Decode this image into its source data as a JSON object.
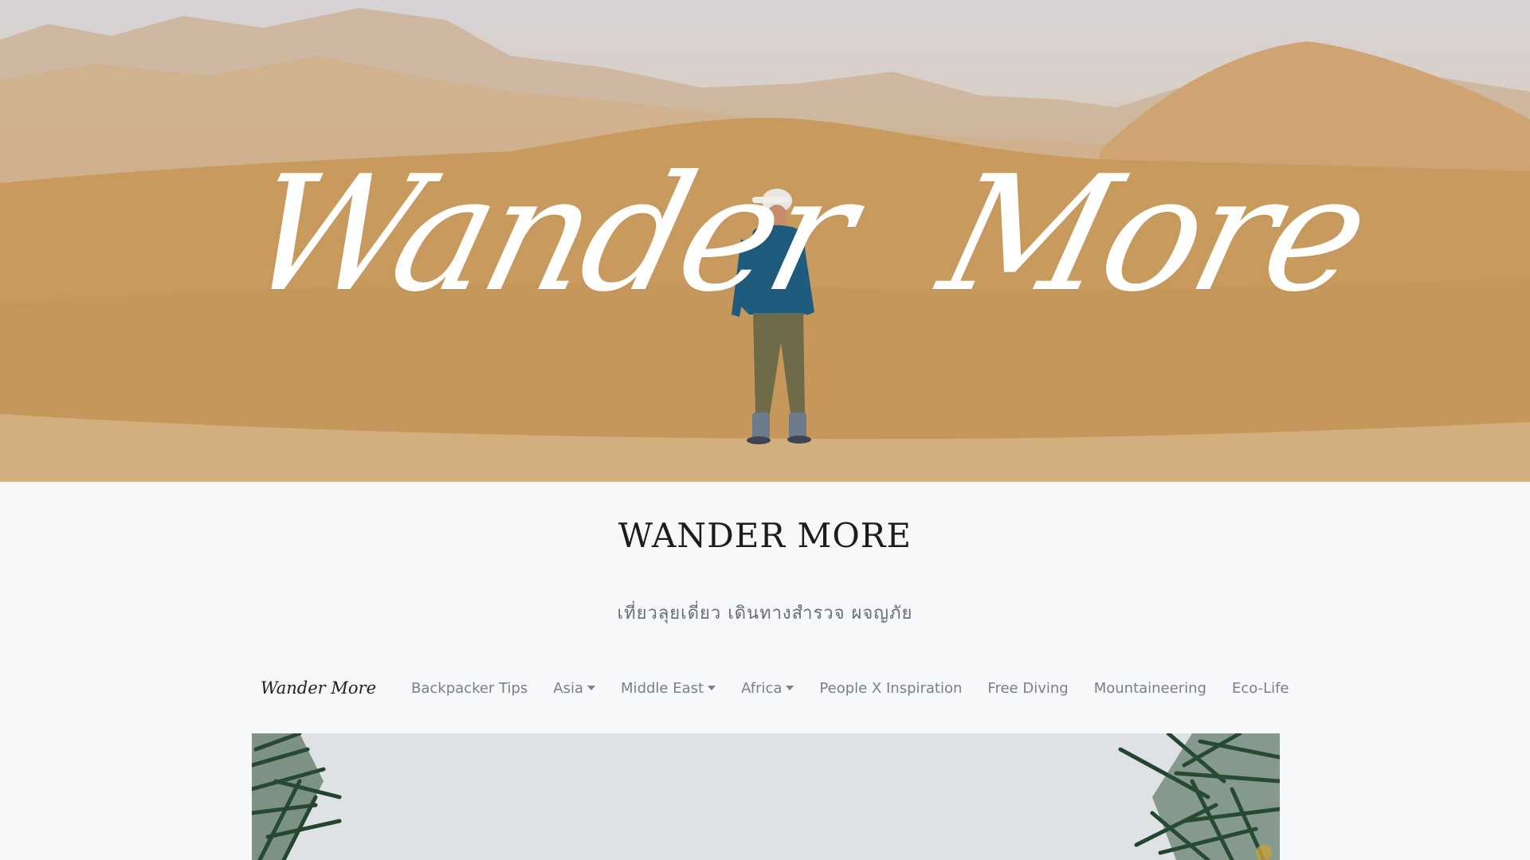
{
  "hero": {
    "script_word_left": "Wander",
    "script_word_right": "More",
    "icons": [
      "desert-dunes-illustration",
      "hiker-figure-illustration"
    ]
  },
  "header": {
    "title": "WANDER MORE",
    "tagline": "เที่ยวลุยเดี่ยว เดินทางสำรวจ ผจญภัย"
  },
  "nav": {
    "brand": "Wander More",
    "items": [
      {
        "label": "Backpacker Tips",
        "has_dropdown": false
      },
      {
        "label": "Asia",
        "has_dropdown": true
      },
      {
        "label": "Middle East",
        "has_dropdown": true
      },
      {
        "label": "Africa",
        "has_dropdown": true
      },
      {
        "label": "People X Inspiration",
        "has_dropdown": false
      },
      {
        "label": "Free Diving",
        "has_dropdown": false
      },
      {
        "label": "Mountaineering",
        "has_dropdown": false
      },
      {
        "label": "Eco-Life",
        "has_dropdown": false
      }
    ]
  },
  "feature": {
    "icons": [
      "palm-trees-illustration"
    ]
  },
  "colors": {
    "background": "#f7f8fa",
    "title_text": "#1b1c1e",
    "nav_text": "#7c7f83",
    "sand": "#c99c62"
  }
}
